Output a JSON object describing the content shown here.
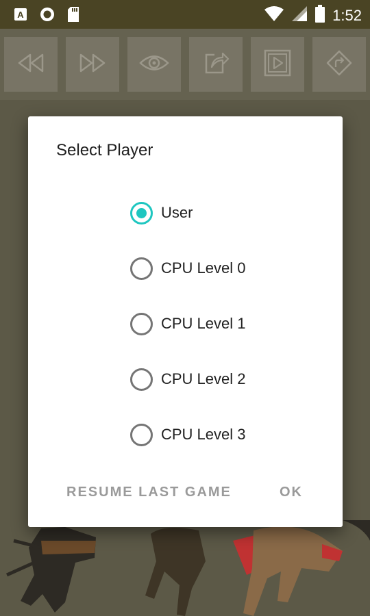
{
  "status_bar": {
    "time": "1:52",
    "notification_icons": [
      "a-icon",
      "circle-icon",
      "sd-card-icon"
    ],
    "system_icons": [
      "wifi-icon",
      "signal-icon",
      "battery-icon"
    ]
  },
  "toolbar": {
    "buttons": [
      "rewind-icon",
      "fast-forward-icon",
      "eye-icon",
      "share-icon",
      "play-icon",
      "route-icon"
    ]
  },
  "dialog": {
    "title": "Select Player",
    "options": [
      "User",
      "CPU Level 0",
      "CPU Level 1",
      "CPU Level 2",
      "CPU Level 3"
    ],
    "selected": "User",
    "resume_label": "RESUME LAST GAME",
    "ok_label": "OK"
  },
  "colors": {
    "accent": "#1ec6c0",
    "status_bar": "#4a4424",
    "button_text": "#9a9a9a"
  }
}
